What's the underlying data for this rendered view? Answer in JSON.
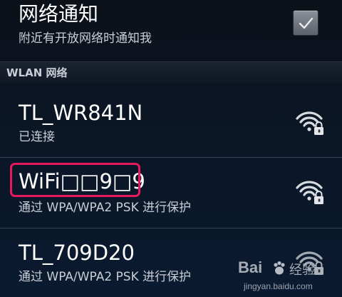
{
  "notify": {
    "title": "网络通知",
    "subtitle": "附近有开放网络时通知我",
    "checked": true
  },
  "section": {
    "header": "WLAN 网络"
  },
  "networks": [
    {
      "name": "TL_WR841N",
      "status": "已连接",
      "icon": "wifi-locked-icon"
    },
    {
      "name": "WiFi□□9□9",
      "status": "通过 WPA/WPA2 PSK 进行保护",
      "icon": "wifi-locked-icon"
    },
    {
      "name": "TL_709D20",
      "status": "通过 WPA/WPA2 PSK 进行保护",
      "icon": "wifi-locked-icon"
    }
  ],
  "watermark": {
    "brand": "Bai",
    "brand_cn": "经验",
    "url": "jingyan.baidu.com"
  },
  "colors": {
    "highlight": "#e8185e",
    "background": "#0b1626"
  }
}
